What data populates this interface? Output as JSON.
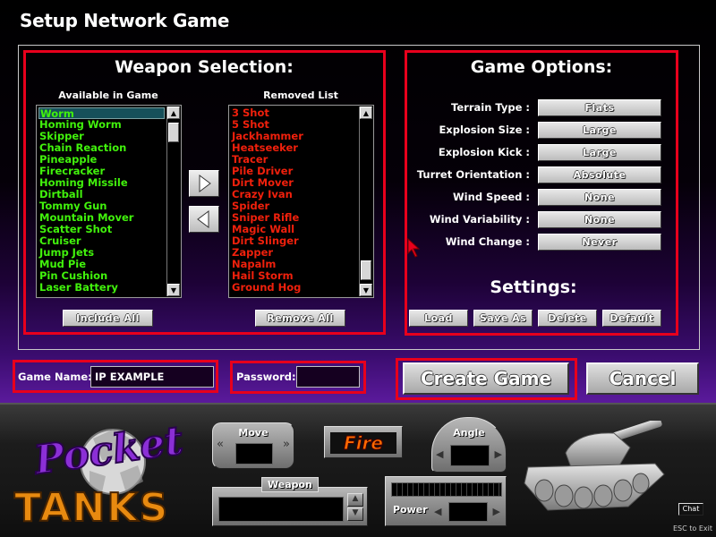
{
  "window": {
    "title": "Setup Network Game"
  },
  "weapon_selection": {
    "heading": "Weapon Selection:",
    "available_header": "Available in Game",
    "removed_header": "Removed List",
    "available": [
      "Worm",
      "Homing Worm",
      "Skipper",
      "Chain Reaction",
      "Pineapple",
      "Firecracker",
      "Homing Missile",
      "Dirtball",
      "Tommy Gun",
      "Mountain Mover",
      "Scatter Shot",
      "Cruiser",
      "Jump Jets",
      "Mud Pie",
      "Pin Cushion",
      "Laser Battery"
    ],
    "available_selected_index": 0,
    "removed": [
      "3 Shot",
      "5 Shot",
      "Jackhammer",
      "Heatseeker",
      "Tracer",
      "Pile Driver",
      "Dirt Mover",
      "Crazy Ivan",
      "Spider",
      "Sniper Rifle",
      "Magic Wall",
      "Dirt Slinger",
      "Zapper",
      "Napalm",
      "Hail Storm",
      "Ground Hog"
    ],
    "include_all": "Include All",
    "remove_all": "Remove All",
    "move_right_icon": "triangle-right-icon",
    "move_left_icon": "triangle-left-icon"
  },
  "game_options": {
    "heading": "Game Options:",
    "options": [
      {
        "label": "Terrain Type :",
        "value": "Flats"
      },
      {
        "label": "Explosion Size :",
        "value": "Large"
      },
      {
        "label": "Explosion Kick :",
        "value": "Large"
      },
      {
        "label": "Turret Orientation :",
        "value": "Absolute"
      },
      {
        "label": "Wind Speed :",
        "value": "None"
      },
      {
        "label": "Wind Variability :",
        "value": "None"
      },
      {
        "label": "Wind Change :",
        "value": "Never"
      }
    ],
    "settings_heading": "Settings:",
    "settings_buttons": [
      "Load",
      "Save As",
      "Delete",
      "Default"
    ]
  },
  "form": {
    "game_name_label": "Game Name:",
    "game_name_value": "IP EXAMPLE",
    "password_label": "Password:",
    "password_value": ""
  },
  "actions": {
    "create": "Create Game",
    "cancel": "Cancel"
  },
  "controls": {
    "move": "Move",
    "fire": "Fire",
    "angle": "Angle",
    "weapon": "Weapon",
    "power": "Power",
    "chat": "Chat",
    "esc": "ESC to Exit"
  },
  "logo": {
    "line1": "Pocket",
    "line2": "TANKS"
  },
  "colors": {
    "highlight_red": "#e8001c",
    "available_green": "#41f20c",
    "removed_red": "#f0200c",
    "fire_orange": "#ff6a00",
    "logo_purple": "#8b2fd6",
    "logo_orange": "#e88a10"
  }
}
